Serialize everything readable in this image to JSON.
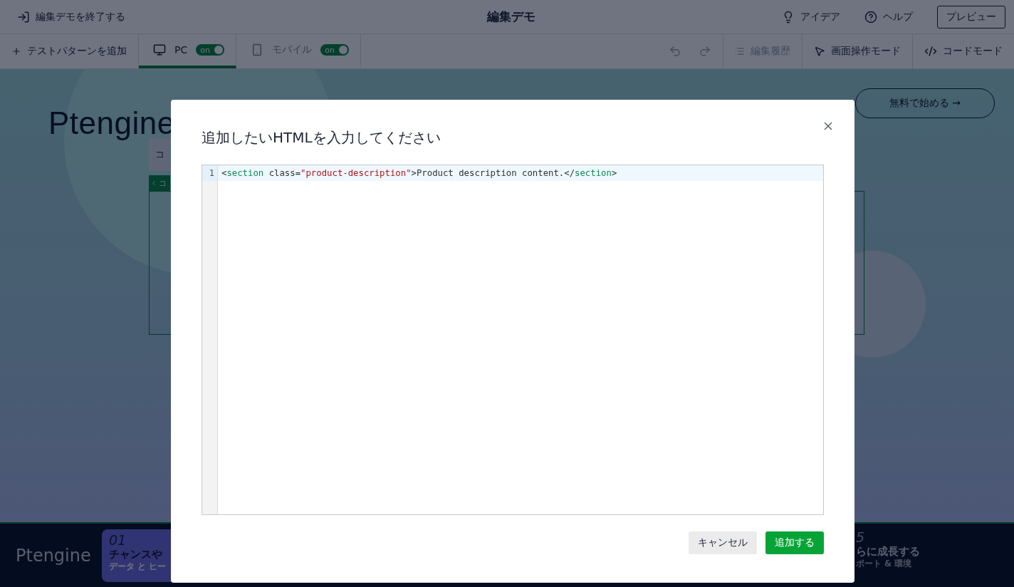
{
  "topbar": {
    "exit_label": "編集デモを終了する",
    "title": "編集デモ",
    "idea": "アイデア",
    "help": "ヘルプ",
    "preview": "プレビュー"
  },
  "toolbar": {
    "add_pattern": "テストパターンを追加",
    "devices": [
      {
        "kind": "pc",
        "label": "PC",
        "selected": true,
        "toggle": "on",
        "on": true
      },
      {
        "kind": "mobile",
        "label": "モバイル",
        "selected": false,
        "toggle": "on",
        "on": true
      }
    ],
    "history": {
      "label": "編集履歴",
      "disabled": true
    },
    "screen_mode": "画面操作モード",
    "code_mode": "コードモード"
  },
  "page": {
    "logo": "Ptengine",
    "cta": "無料で始める →",
    "element_tab": "コ",
    "element_label": "コ"
  },
  "footer": {
    "logo": "Ptengine",
    "card": {
      "number": "01",
      "title": "チャンスや",
      "subtitle": "データ と ヒー"
    },
    "right": {
      "number": "5",
      "title": "らに成長する",
      "subtitle": "ポート & 環境"
    }
  },
  "modal": {
    "title": "追加したいHTMLを入力してください",
    "lines": [
      {
        "number": "1",
        "highlighted": true,
        "tokens": [
          {
            "kind": "punct",
            "text": "<"
          },
          {
            "kind": "tag",
            "text": "section"
          },
          {
            "kind": "attr",
            "text": " class="
          },
          {
            "kind": "string",
            "text": "\"product-description\""
          },
          {
            "kind": "text",
            "text": ">Product description content.</"
          },
          {
            "kind": "tag",
            "text": "section"
          },
          {
            "kind": "punct",
            "text": ">"
          }
        ]
      }
    ],
    "cancel": "キャンセル",
    "confirm": "追加する"
  }
}
